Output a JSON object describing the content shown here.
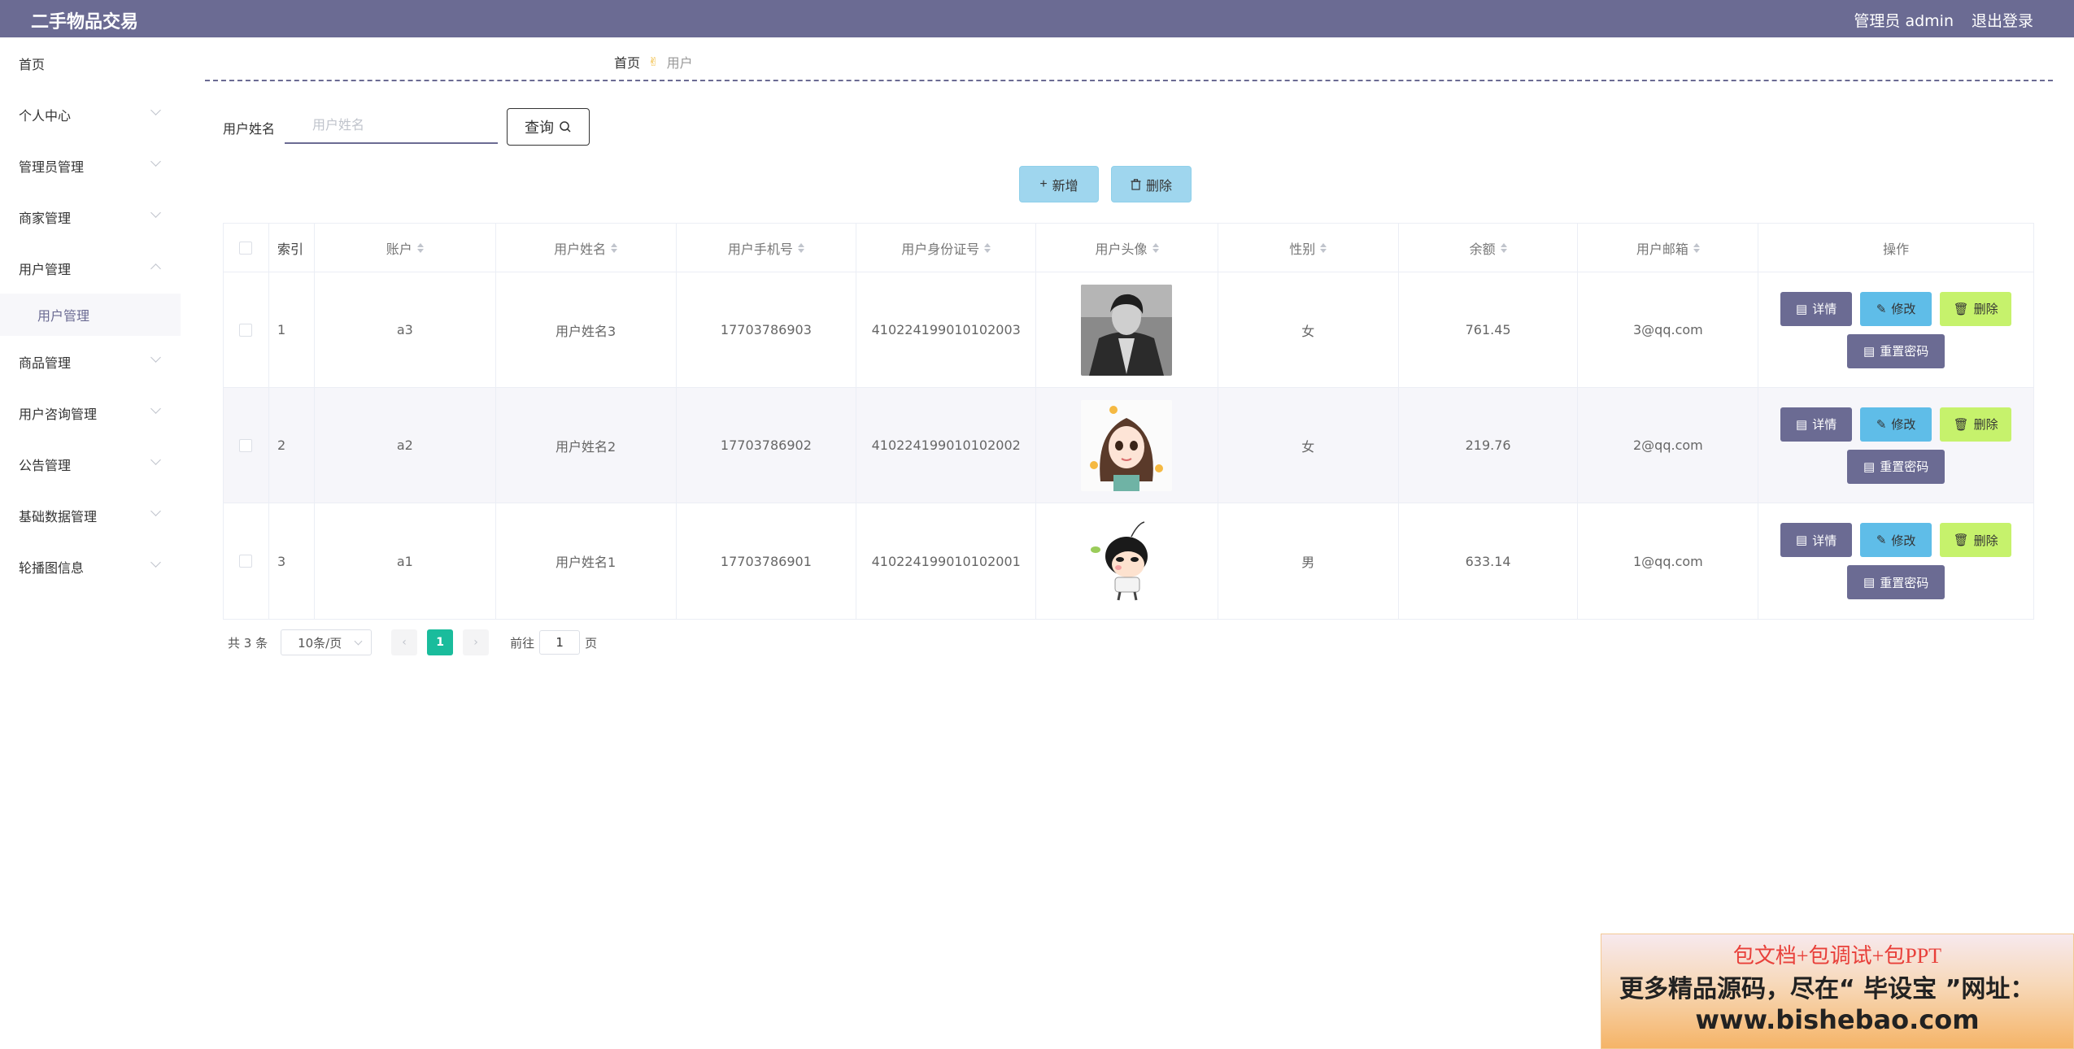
{
  "header": {
    "brand": "二手物品交易",
    "admin_label": "管理员 admin",
    "logout": "退出登录",
    "bg_color": "#6b6b93"
  },
  "sidebar": {
    "items": [
      {
        "label": "首页",
        "has_arrow": false
      },
      {
        "label": "个人中心",
        "has_arrow": true
      },
      {
        "label": "管理员管理",
        "has_arrow": true
      },
      {
        "label": "商家管理",
        "has_arrow": true
      },
      {
        "label": "用户管理",
        "has_arrow": true,
        "expanded": true,
        "children": [
          "用户管理"
        ]
      },
      {
        "label": "商品管理",
        "has_arrow": true
      },
      {
        "label": "用户咨询管理",
        "has_arrow": true
      },
      {
        "label": "公告管理",
        "has_arrow": true
      },
      {
        "label": "基础数据管理",
        "has_arrow": true
      },
      {
        "label": "轮播图信息",
        "has_arrow": true
      }
    ]
  },
  "breadcrumb": {
    "home": "首页",
    "separator_icon": "hand-icon",
    "current": "用户"
  },
  "search": {
    "label": "用户姓名",
    "placeholder": "用户姓名",
    "value": "",
    "button": "查询"
  },
  "actions": {
    "add": "新增",
    "delete": "删除"
  },
  "table": {
    "columns": [
      "索引",
      "账户",
      "用户姓名",
      "用户手机号",
      "用户身份证号",
      "用户头像",
      "性别",
      "余额",
      "用户邮箱",
      "操作"
    ],
    "rows": [
      {
        "index": "1",
        "account": "a3",
        "name": "用户姓名3",
        "phone": "17703786903",
        "id_card": "410224199010102003",
        "avatar": "photo-portrait",
        "sex": "女",
        "balance": "761.45",
        "email": "3@qq.com"
      },
      {
        "index": "2",
        "account": "a2",
        "name": "用户姓名2",
        "phone": "17703786902",
        "id_card": "410224199010102002",
        "avatar": "cartoon-girl",
        "sex": "女",
        "balance": "219.76",
        "email": "2@qq.com"
      },
      {
        "index": "3",
        "account": "a1",
        "name": "用户姓名1",
        "phone": "17703786901",
        "id_card": "410224199010102001",
        "avatar": "cartoon-boy",
        "sex": "男",
        "balance": "633.14",
        "email": "1@qq.com"
      }
    ],
    "ops": {
      "detail": "详情",
      "edit": "修改",
      "delete": "删除",
      "reset": "重置密码"
    }
  },
  "pagination": {
    "total": "共 3 条",
    "page_size": "10条/页",
    "current_page": "1",
    "goto_prefix": "前往",
    "goto_value": "1",
    "goto_suffix": "页"
  },
  "banner": {
    "line1": "包文档+包调试+包PPT",
    "line2": "更多精品源码，尽在“ 毕设宝 ”网址：",
    "line3": "www.bishebao.com"
  }
}
